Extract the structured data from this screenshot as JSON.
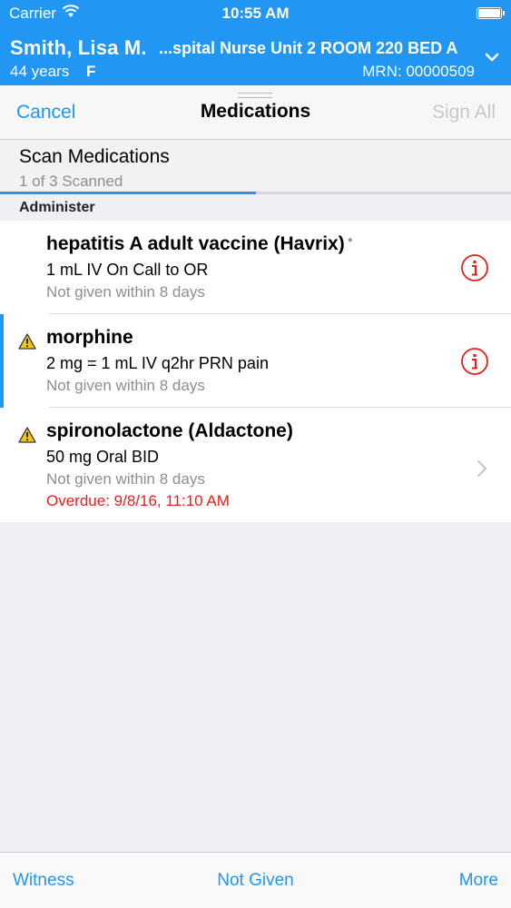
{
  "status_bar": {
    "carrier": "Carrier",
    "time": "10:55 AM"
  },
  "patient": {
    "name": "Smith, Lisa M.",
    "location": "...spital Nurse Unit 2 ROOM 220 BED A",
    "age": "44 years",
    "sex": "F",
    "mrn": "MRN: 00000509"
  },
  "nav": {
    "cancel_label": "Cancel",
    "title": "Medications",
    "sign_all_label": "Sign All"
  },
  "scan": {
    "title": "Scan Medications",
    "count_text": "1 of 3 Scanned",
    "progress": 0.5
  },
  "section": {
    "title": "Administer"
  },
  "medications": [
    {
      "name": "hepatitis A adult vaccine (Havrix)",
      "dose": "1 mL IV On Call to OR",
      "status": "Not given within 8 days",
      "overdue": "",
      "warning": false,
      "action": "info-icon"
    },
    {
      "name": "morphine",
      "dose": "2 mg = 1 mL IV q2hr PRN pain",
      "status": "Not given within 8 days",
      "overdue": "",
      "warning": true,
      "action": "info-icon"
    },
    {
      "name": "spironolactone (Aldactone)",
      "dose": "50 mg Oral BID",
      "status": "Not given within 8 days",
      "overdue": "Overdue: 9/8/16, 11:10 AM",
      "warning": true,
      "action": "chevron-right-icon"
    }
  ],
  "toolbar": {
    "witness_label": "Witness",
    "not_given_label": "Not Given",
    "more_label": "More"
  },
  "colors": {
    "accent": "#2196f3",
    "alert": "#e8201c",
    "warning": "#f5c518",
    "muted": "#8e8e93"
  }
}
